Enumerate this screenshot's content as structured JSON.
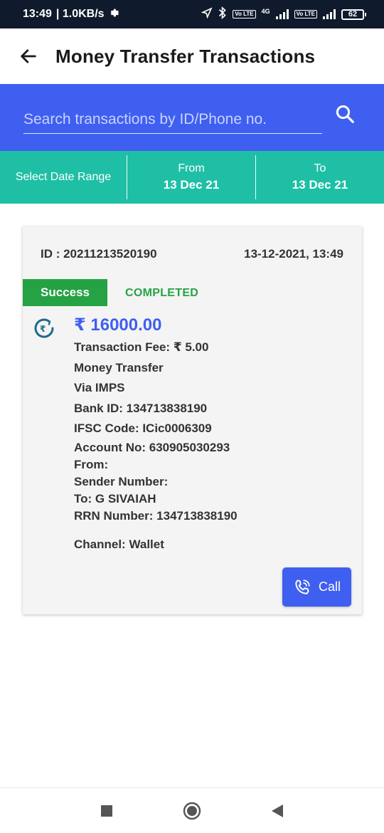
{
  "status_bar": {
    "time": "13:49",
    "speed": "| 1.0KB/s",
    "network_label": "4G",
    "volte_label": "Vo LTE",
    "battery": "62"
  },
  "app_bar": {
    "title": "Money Transfer Transactions",
    "back_icon": "arrow-left-icon"
  },
  "search": {
    "placeholder": "Search transactions by ID/Phone no.",
    "value": "",
    "icon": "search-icon"
  },
  "date_range": {
    "label": "Select Date Range",
    "from_label": "From",
    "from_value": "13 Dec 21",
    "to_label": "To",
    "to_value": "13 Dec 21"
  },
  "transaction": {
    "id_text": "ID : 20211213520190",
    "datetime": "13-12-2021, 13:49",
    "badge": "Success",
    "status": "COMPLETED",
    "amount": "₹ 16000.00",
    "fee": "Transaction Fee: ₹ 5.00",
    "type": "Money Transfer",
    "via": "Via  IMPS",
    "bank_id": "Bank ID:  134713838190",
    "ifsc": "IFSC Code:  ICic0006309",
    "account": "Account No: 630905030293",
    "from": "From:",
    "sender": "Sender Number:",
    "to": "To:  G SIVAIAH",
    "rrn": "RRN Number:  134713838190",
    "channel": "Channel:  Wallet",
    "call_label": "Call"
  },
  "colors": {
    "primary": "#3f5ff0",
    "teal": "#1fbfa6",
    "success": "#25a244",
    "status_bar": "#0f1b2d"
  }
}
